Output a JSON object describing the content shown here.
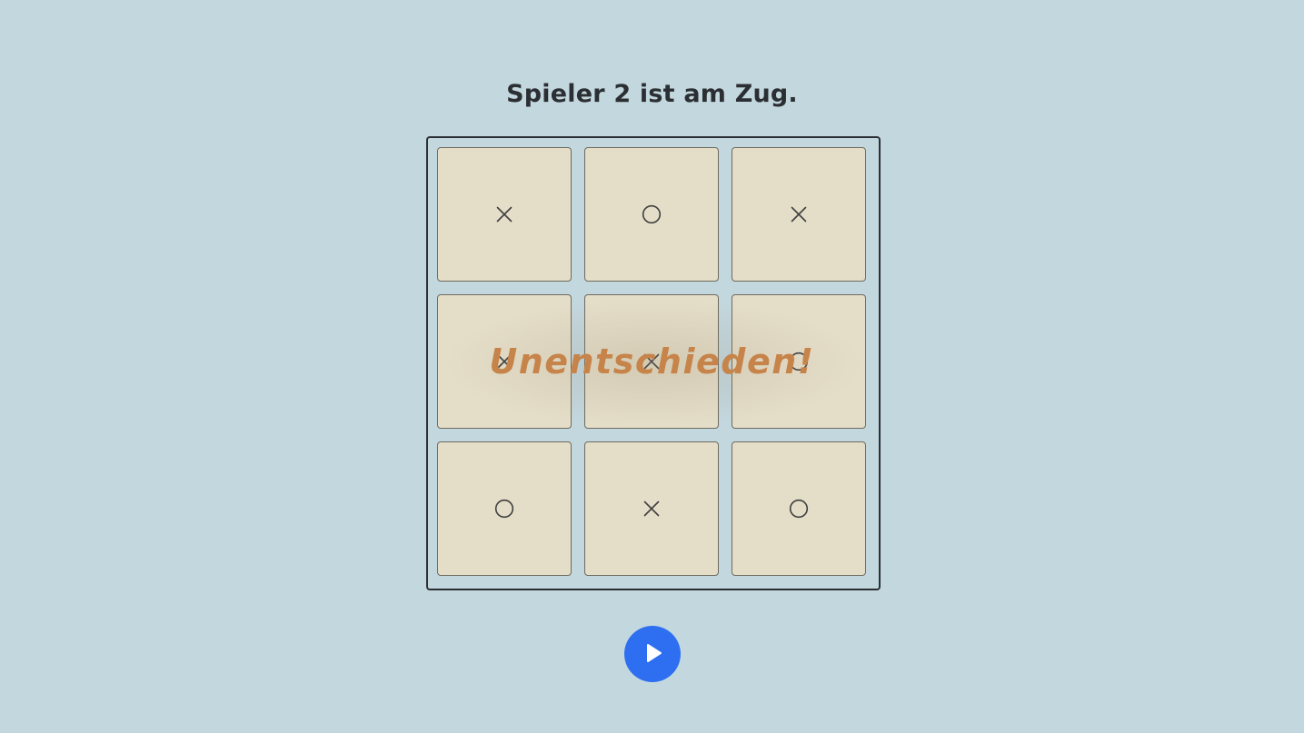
{
  "game": {
    "status_text": "Spieler 2 ist am Zug.",
    "result_text": "Unentschieden!",
    "board": [
      [
        "X",
        "O",
        "X"
      ],
      [
        "X",
        "X",
        "O"
      ],
      [
        "O",
        "X",
        "O"
      ]
    ]
  },
  "controls": {
    "play_icon": "play-icon"
  },
  "colors": {
    "background": "#c3d7de",
    "cell": "#e4ddc8",
    "result_text": "#c7844a",
    "play_button": "#2d6ff0"
  }
}
